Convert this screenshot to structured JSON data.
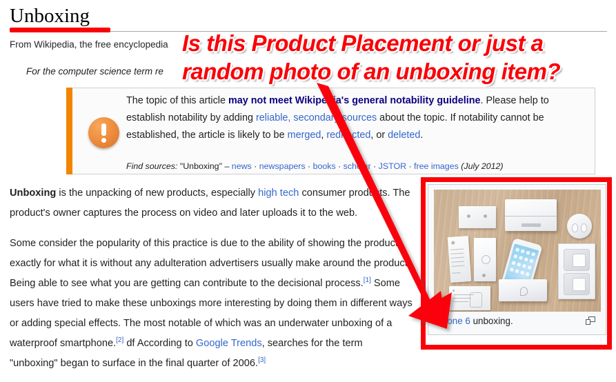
{
  "article": {
    "title": "Unboxing",
    "subtitle": "From Wikipedia, the free encyclopedia",
    "hatnote": "For the computer science term re",
    "hatnote_full": "For the computer science term referring to the conversion of a value type to a reference type, see Boxing (computer science)."
  },
  "notability_box": {
    "icon": "exclamation-circle-icon",
    "stripe_color": "#f28500",
    "line1_a": "The topic of this article ",
    "line1_bold_link": "may not meet Wikipedia's general notability guideline",
    "line1_b": ".",
    "line2_a": "Please help to establish notability by adding ",
    "line2_link1": "reliable, secondary sources",
    "line2_b": " about the topic. If notability cannot be established, the article is likely to be ",
    "line2_link2": "merged",
    "line2_c": ", ",
    "line2_link3": "redirected",
    "line2_d": ", or ",
    "line2_link4": "deleted",
    "line2_e": ".",
    "find_sources_label": "Find sources:",
    "find_sources_query": "\"Unboxing\"",
    "find_sources_dash": "–",
    "find_sources_links": [
      "news",
      "newspapers",
      "books",
      "scholar",
      "JSTOR",
      "free images"
    ],
    "find_sources_date": "(July 2012)"
  },
  "body": {
    "p1_bold": "Unboxing",
    "p1_a": " is the unpacking of new products, especially ",
    "p1_link": "high tech",
    "p1_b": " consumer products. The product's owner captures the process on video and later uploads it to the web.",
    "p2_a": "Some consider the popularity of this practice is due to the ability of showing the product exactly for what it is without any adulteration advertisers usually make around the product. Being able to see what you are getting can contribute to the decisional process.",
    "p2_ref1": "[1]",
    "p2_b": " Some users have tried to make these unboxings more interesting by doing them in different ways or adding special effects. The most notable of which was an underwater unboxing of a waterproof smartphone.",
    "p2_ref2": "[2]",
    "p2_c": " df According to ",
    "p2_link": "Google Trends",
    "p2_d": ", searches for the term \"unboxing\" began to surface in the final quarter of 2006.",
    "p2_ref3": "[3]"
  },
  "thumbnail": {
    "caption_link": "iPhone 6",
    "caption_rest": " unboxing.",
    "enlarge_icon": "enlarge-icon",
    "photo_alt": "iPhone 6 unboxing photo: box, phone, earpods, charger and documentation laid out on a wooden table"
  },
  "annotation": {
    "line1": "Is this Product Placement or just a",
    "line2": "random photo of an unboxing item?",
    "color": "#fb0007",
    "arrow": "red-arrow-icon",
    "highlight_box": "red-rectangle-highlight",
    "title_underline": "red-underline-mark"
  },
  "colors": {
    "link": "#3366cc",
    "link_dark": "#0b0080",
    "annotation_red": "#fb0007",
    "ambox_stripe": "#f28500",
    "text": "#202122"
  }
}
